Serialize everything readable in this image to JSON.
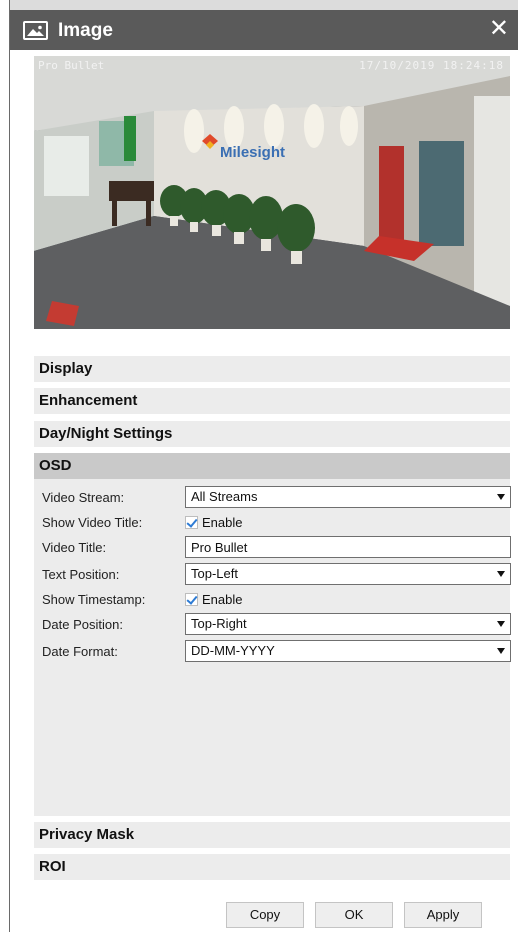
{
  "dialog": {
    "title": "Image",
    "close_symbol": "✕"
  },
  "preview": {
    "osd_title": "Pro Bullet",
    "osd_timestamp": "17/10/2019 18:24:18",
    "wall_logo": "Milesight"
  },
  "sections": {
    "display": "Display",
    "enhancement": "Enhancement",
    "day_night": "Day/Night Settings",
    "osd": "OSD",
    "privacy_mask": "Privacy Mask",
    "roi": "ROI"
  },
  "osd": {
    "video_stream_label": "Video Stream:",
    "video_stream_value": "All Streams",
    "show_video_title_label": "Show Video Title:",
    "show_video_title_checked": true,
    "show_video_title_option": "Enable",
    "video_title_label": "Video Title:",
    "video_title_value": "Pro Bullet",
    "text_position_label": "Text Position:",
    "text_position_value": "Top-Left",
    "show_timestamp_label": "Show Timestamp:",
    "show_timestamp_checked": true,
    "show_timestamp_option": "Enable",
    "date_position_label": "Date Position:",
    "date_position_value": "Top-Right",
    "date_format_label": "Date Format:",
    "date_format_value": "DD-MM-YYYY"
  },
  "buttons": {
    "copy": "Copy",
    "ok": "OK",
    "apply": "Apply"
  },
  "icons": {
    "title_icon": "image-icon",
    "close_icon": "close-icon",
    "dropdown_icon": "chevron-down-icon",
    "checkbox_icon": "checkmark-icon"
  }
}
